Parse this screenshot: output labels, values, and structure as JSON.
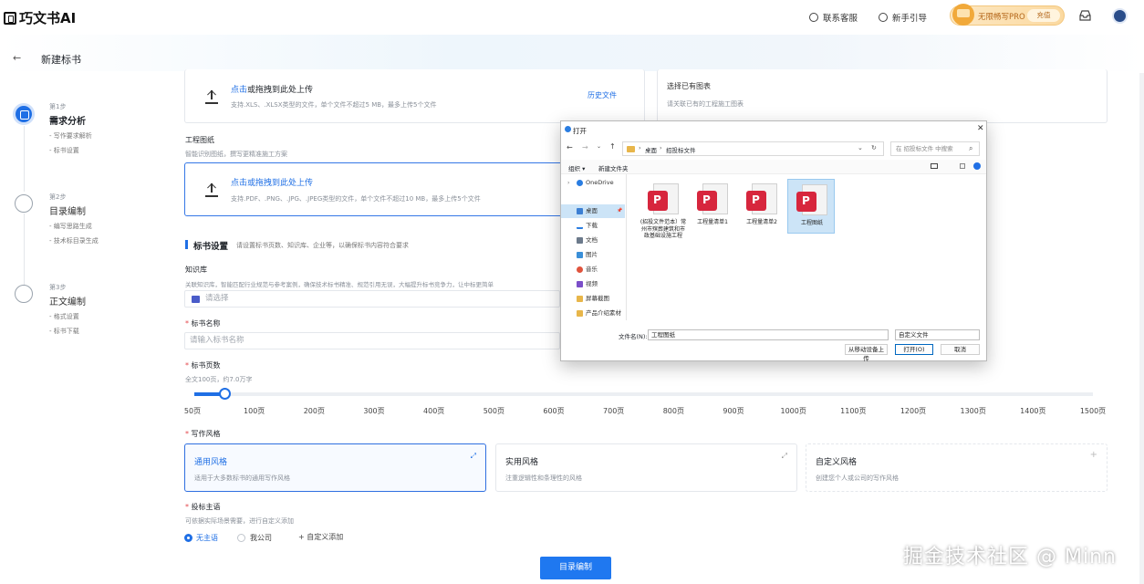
{
  "header": {
    "logo_text": "巧文书AI",
    "links": [
      "联系客服",
      "新手引导"
    ],
    "promo_text": "无限畅写PRO",
    "promo_button": "充值"
  },
  "page": {
    "back": "←",
    "title": "新建标书"
  },
  "steps": [
    {
      "num": "第1步",
      "title": "需求分析",
      "subs": [
        "- 写作要求解析",
        "- 标书设置"
      ]
    },
    {
      "num": "第2步",
      "title": "目录编制",
      "subs": [
        "- 编写思路生成",
        "- 技术标目录生成"
      ]
    },
    {
      "num": "第3步",
      "title": "正文编制",
      "subs": [
        "- 格式设置",
        "- 标书下载"
      ]
    }
  ],
  "upload1": {
    "link": "点击",
    "text": "或拖拽到此处上传",
    "hint": "支持.XLS、.XLSX类型的文件，单个文件不超过5 MB，最多上传5个文件",
    "history": "历史文件"
  },
  "chart_pick": {
    "title": "选择已有图表",
    "hint": "请关联已有的工程施工图表"
  },
  "drawings": {
    "label": "工程图纸",
    "hint": "智能识别图纸，撰写更精准施工方案",
    "link": "点击或拖拽到此处上传",
    "formats": "支持.PDF、.PNG、.JPG、.JPEG类型的文件，单个文件不超过10 MB，最多上传5个文件"
  },
  "settings": {
    "title": "标书设置",
    "hint": "请设置标书页数、知识库、企业等，以确保标书内容符合要求"
  },
  "kb": {
    "label": "知识库",
    "hint": "关联知识库，智能匹配行业规范与参考案例，确保技术标书精准、规范引用无误，大幅提升标书竞争力，让中标更简单",
    "placeholder": "请选择"
  },
  "name": {
    "label": "标书名称",
    "placeholder": "请输入标书名称"
  },
  "pages": {
    "label": "标书页数",
    "hint": "全文100页，约7.0万字",
    "ticks": [
      "50页",
      "100页",
      "200页",
      "300页",
      "400页",
      "500页",
      "600页",
      "700页",
      "800页",
      "900页",
      "1000页",
      "1100页",
      "1200页",
      "1300页",
      "1400页",
      "1500页"
    ],
    "value_fraction": 0.033
  },
  "style": {
    "label": "写作风格",
    "options": [
      {
        "title": "通用风格",
        "desc": "适用于大多数标书的通用写作风格"
      },
      {
        "title": "实用风格",
        "desc": "注重逻辑性和条理性的风格"
      },
      {
        "title": "自定义风格",
        "desc": "创建您个人或公司的写作风格"
      }
    ]
  },
  "subject": {
    "label": "投标主语",
    "hint": "可依据实际场景需要，进行自定义添加",
    "options": [
      "无主语",
      "我公司"
    ],
    "add": "自定义添加"
  },
  "cta": "目录编制",
  "watermark": "掘金技术社区 @ Minn",
  "dialog": {
    "title": "打开",
    "close": "✕",
    "path": [
      "桌面",
      "招投标文件"
    ],
    "search": "在 招投标文件 中搜索",
    "toolbar": [
      "组织 ▾",
      "新建文件夹"
    ],
    "tree": [
      "OneDrive",
      "桌面",
      "下载",
      "文档",
      "图片",
      "音乐",
      "视频",
      "屏幕截图",
      "产品介绍素材"
    ],
    "files": [
      "(招投文件范本）常州市殡葬建筑和市政基础设施工程",
      "工程量清单1",
      "工程量清单2",
      "工程图纸"
    ],
    "filename_label": "文件名(N):",
    "filename": "工程图纸",
    "filetype": "自定义文件",
    "btn_mobile": "从移动设备上传",
    "btn_open": "打开(O)",
    "btn_cancel": "取消"
  }
}
